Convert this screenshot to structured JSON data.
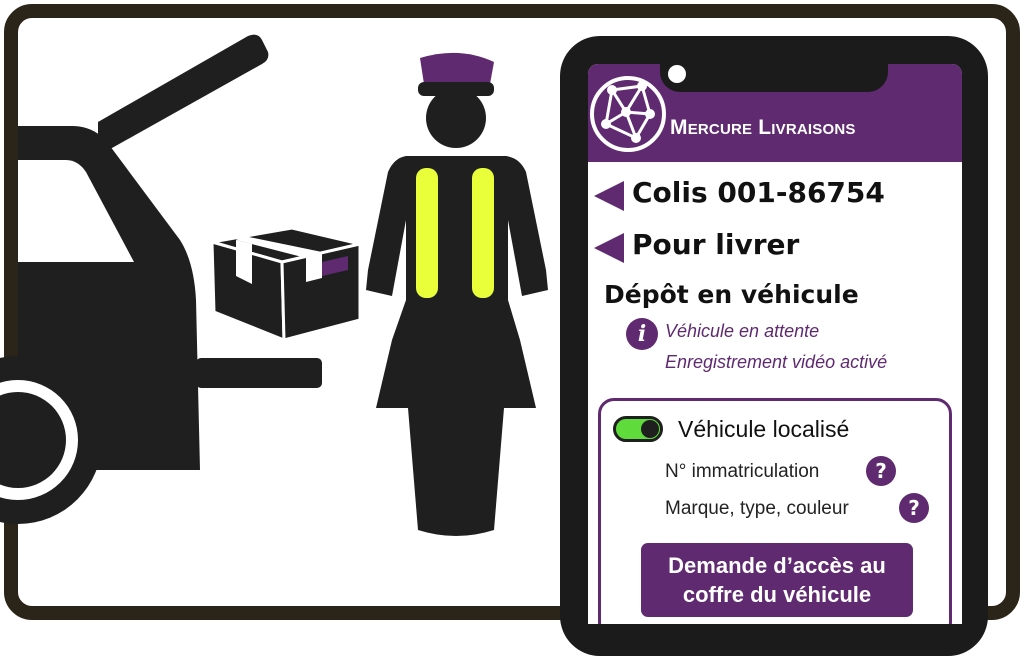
{
  "app": {
    "title": "Mercure Livraisons",
    "logo_icon": "globe-network-icon",
    "brand_color": "#5f2a70"
  },
  "nav": {
    "parcel_back_label": "Colis 001-86754",
    "status_back_label": "Pour livrer"
  },
  "delivery": {
    "method_title": "Dépôt en véhicule",
    "info_icon_glyph": "i",
    "status_lines": [
      "Véhicule en attente",
      "Enregistrement vidéo activé"
    ]
  },
  "vehicle_card": {
    "toggle_on": true,
    "toggle_color": "#5fdc3c",
    "toggle_label": "Véhicule localisé",
    "fields": [
      "N° immatriculation",
      "Marque, type, couleur"
    ],
    "help_glyph": "?",
    "access_button_line1": "Demande d’accès au",
    "access_button_line2": "coffre du véhicule"
  },
  "illustration": {
    "icons": [
      "car-open-trunk-icon",
      "parcel-box-icon",
      "courier-with-safety-vest-icon"
    ],
    "vest_color": "#e8ff3a",
    "figure_color": "#1f1f1f"
  }
}
